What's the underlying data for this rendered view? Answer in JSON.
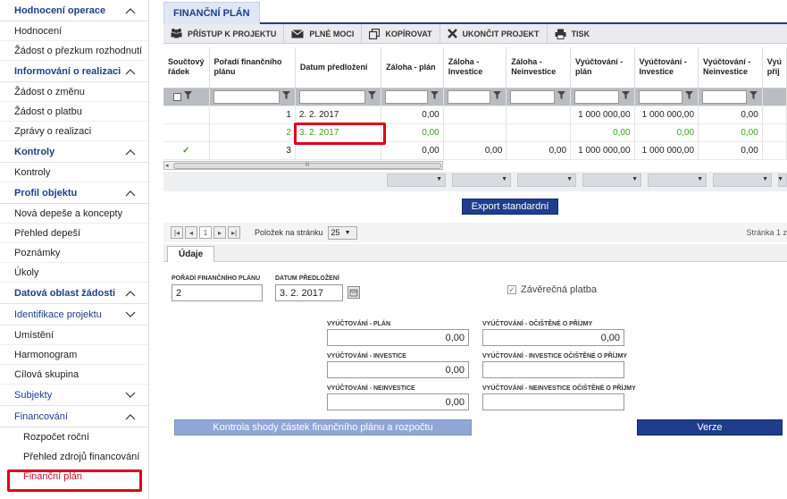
{
  "sidebar": {
    "items": [
      {
        "label": "Hodnocení operace",
        "type": "header",
        "expanded": true
      },
      {
        "label": "Hodnocení",
        "type": "item"
      },
      {
        "label": "Žádost o přezkum rozhodnutí",
        "type": "item"
      },
      {
        "label": "Informování o realizaci",
        "type": "header",
        "expanded": true
      },
      {
        "label": "Žádost o změnu",
        "type": "item"
      },
      {
        "label": "Žádost o platbu",
        "type": "item"
      },
      {
        "label": "Zprávy o realizaci",
        "type": "item"
      },
      {
        "label": "Kontroly",
        "type": "header",
        "expanded": true
      },
      {
        "label": "Kontroly",
        "type": "item"
      },
      {
        "label": "Profil objektu",
        "type": "header",
        "expanded": true
      },
      {
        "label": "Nová depeše a koncepty",
        "type": "item"
      },
      {
        "label": "Přehled depeší",
        "type": "item"
      },
      {
        "label": "Poznámky",
        "type": "item"
      },
      {
        "label": "Úkoly",
        "type": "item"
      },
      {
        "label": "Datová oblast žádosti",
        "type": "header",
        "expanded": true
      },
      {
        "label": "Identifikace projektu",
        "type": "header2",
        "expanded": false
      },
      {
        "label": "Umístění",
        "type": "item"
      },
      {
        "label": "Harmonogram",
        "type": "item"
      },
      {
        "label": "Cílová skupina",
        "type": "item"
      },
      {
        "label": "Subjekty",
        "type": "header2",
        "expanded": false
      },
      {
        "label": "Financování",
        "type": "header2",
        "expanded": true
      },
      {
        "label": "Rozpočet roční",
        "type": "sub"
      },
      {
        "label": "Přehled zdrojů financování",
        "type": "sub"
      },
      {
        "label": "Finanční plán",
        "type": "sub",
        "active": true
      }
    ]
  },
  "main_tab": "FINANČNÍ PLÁN",
  "toolbar": {
    "pristup": "PŘÍSTUP K PROJEKTU",
    "plne_moci": "PLNÉ MOCI",
    "kopirovat": "KOPÍROVAT",
    "ukoncit": "UKONČIT PROJEKT",
    "tisk": "TISK"
  },
  "grid": {
    "columns": [
      "Součtový řádek",
      "Pořadí finančního plánu",
      "Datum předložení",
      "Záloha - plán",
      "Záloha - Investice",
      "Záloha - Neinvestice",
      "Vyúčtování - plán",
      "Vyúčtování - Investice",
      "Vyúčtování - Neinvestice",
      "Vyú příj"
    ],
    "rows": [
      {
        "soucet": "",
        "poradi": "1",
        "datum": "2. 2. 2017",
        "zal_plan": "0,00",
        "zal_inv": "",
        "zal_neinv": "",
        "vyu_plan": "1 000 000,00",
        "vyu_inv": "1 000 000,00",
        "vyu_neinv": "0,00",
        "selected": false
      },
      {
        "soucet": "",
        "poradi": "2",
        "datum": "3. 2. 2017",
        "zal_plan": "0,00",
        "zal_inv": "",
        "zal_neinv": "",
        "vyu_plan": "0,00",
        "vyu_inv": "0,00",
        "vyu_neinv": "0,00",
        "selected": true
      },
      {
        "soucet": "✓",
        "poradi": "3",
        "datum": "",
        "zal_plan": "0,00",
        "zal_inv": "0,00",
        "zal_neinv": "0,00",
        "vyu_plan": "1 000 000,00",
        "vyu_inv": "1 000 000,00",
        "vyu_neinv": "0,00",
        "selected": false
      }
    ]
  },
  "scroll_marker": "III",
  "export_label": "Export standardní",
  "pager": {
    "page": "1",
    "per_page_label": "Položek na stránku",
    "per_page": "25",
    "page_info": "Stránka 1 z"
  },
  "detail_tab": "Údaje",
  "form": {
    "poradi_label": "POŘADÍ FINANČNÍHO PLÁNU",
    "poradi_value": "2",
    "datum_label": "DATUM PŘEDLOŽENÍ",
    "datum_value": "3. 2. 2017",
    "zaverecna_label": "Závěrečná platba",
    "vyu_plan_label": "VYÚČTOVÁNÍ - PLÁN",
    "vyu_plan_value": "0,00",
    "vyu_plan_ocist_label": "VYÚČTOVÁNÍ - OČIŠTĚNÉ O PŘÍJMY",
    "vyu_plan_ocist_value": "0,00",
    "vyu_inv_label": "VYÚČTOVÁNÍ - INVESTICE",
    "vyu_inv_value": "0,00",
    "vyu_inv_ocist_label": "VYÚČTOVÁNÍ - INVESTICE OČIŠTĚNÉ O PŘÍJMY",
    "vyu_inv_ocist_value": "",
    "vyu_neinv_label": "VYÚČTOVÁNÍ - NEINVESTICE",
    "vyu_neinv_value": "0,00",
    "vyu_neinv_ocist_label": "VYÚČTOVÁNÍ - NEINVESTICE OČIŠTĚNÉ O PŘÍJMY",
    "vyu_neinv_ocist_value": ""
  },
  "buttons": {
    "kontrola": "Kontrola shody částek finančního plánu a rozpočtu",
    "verze": "Verze"
  },
  "colors": {
    "accent": "#1f3d8c",
    "highlight": "#e0001a",
    "green": "#3ea01a"
  }
}
